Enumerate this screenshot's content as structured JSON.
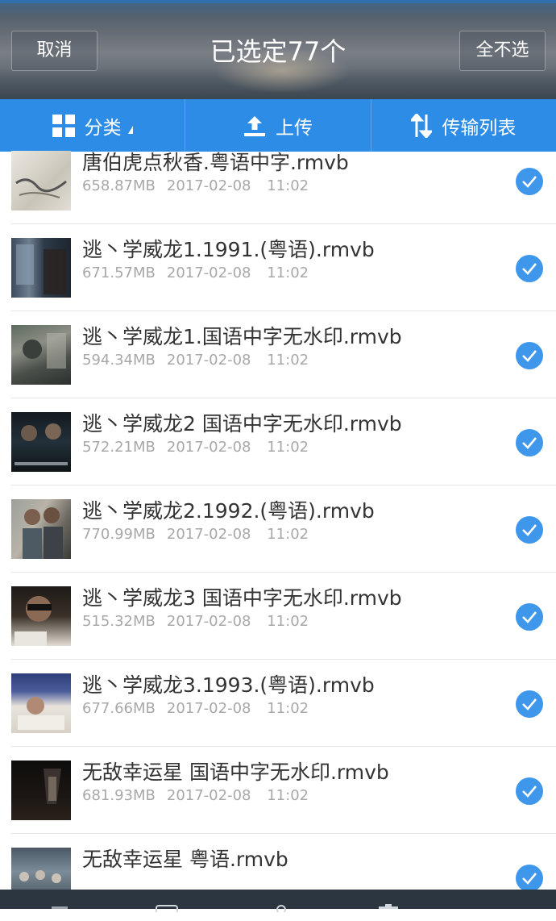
{
  "header": {
    "cancel_label": "取消",
    "title": "已选定77个",
    "deselect_all_label": "全不选"
  },
  "toolbar": {
    "category_label": "分类",
    "upload_label": "上传",
    "transfer_label": "传输列表"
  },
  "files": [
    {
      "name": "唐伯虎点秋香.粤语中字.rmvb",
      "size": "658.87MB",
      "date": "2017-02-08",
      "time": "11:02",
      "selected": true
    },
    {
      "name": "逃丶学威龙1.1991.(粤语).rmvb",
      "size": "671.57MB",
      "date": "2017-02-08",
      "time": "11:02",
      "selected": true
    },
    {
      "name": "逃丶学威龙1.国语中字无水印.rmvb",
      "size": "594.34MB",
      "date": "2017-02-08",
      "time": "11:02",
      "selected": true
    },
    {
      "name": "逃丶学威龙2 国语中字无水印.rmvb",
      "size": "572.21MB",
      "date": "2017-02-08",
      "time": "11:02",
      "selected": true
    },
    {
      "name": "逃丶学威龙2.1992.(粤语).rmvb",
      "size": "770.99MB",
      "date": "2017-02-08",
      "time": "11:02",
      "selected": true
    },
    {
      "name": "逃丶学威龙3 国语中字无水印.rmvb",
      "size": "515.32MB",
      "date": "2017-02-08",
      "time": "11:02",
      "selected": true
    },
    {
      "name": "逃丶学威龙3.1993.(粤语).rmvb",
      "size": "677.66MB",
      "date": "2017-02-08",
      "time": "11:02",
      "selected": true
    },
    {
      "name": "无敌幸运星 国语中字无水印.rmvb",
      "size": "681.93MB",
      "date": "2017-02-08",
      "time": "11:02",
      "selected": true
    },
    {
      "name": "无敌幸运星 粤语.rmvb",
      "size": "",
      "date": "",
      "time": "",
      "selected": true
    }
  ],
  "colors": {
    "accent": "#2d8ce6",
    "check": "#3e97ea",
    "bottom_bar": "#2c3641"
  }
}
